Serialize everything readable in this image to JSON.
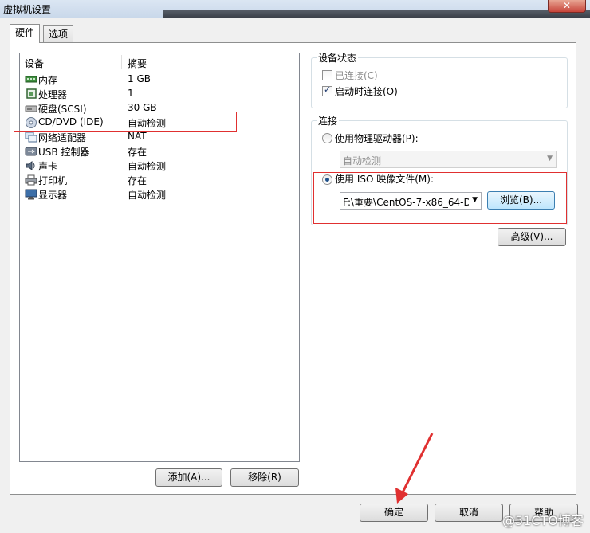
{
  "window": {
    "title": "虚拟机设置",
    "close": "✕"
  },
  "tabs": [
    {
      "label": "硬件"
    },
    {
      "label": "选项"
    }
  ],
  "devices": {
    "header": {
      "device": "设备",
      "summary": "摘要"
    },
    "rows": [
      {
        "name": "内存",
        "summary": "1 GB",
        "icon": "memory-icon"
      },
      {
        "name": "处理器",
        "summary": "1",
        "icon": "processor-icon"
      },
      {
        "name": "硬盘(SCSI)",
        "summary": "30 GB",
        "icon": "harddisk-icon"
      },
      {
        "name": "CD/DVD (IDE)",
        "summary": "自动检测",
        "icon": "cd-dvd-icon"
      },
      {
        "name": "网络适配器",
        "summary": "NAT",
        "icon": "network-adapter-icon"
      },
      {
        "name": "USB 控制器",
        "summary": "存在",
        "icon": "usb-icon"
      },
      {
        "name": "声卡",
        "summary": "自动检测",
        "icon": "sound-icon"
      },
      {
        "name": "打印机",
        "summary": "存在",
        "icon": "printer-icon"
      },
      {
        "name": "显示器",
        "summary": "自动检测",
        "icon": "display-icon"
      }
    ],
    "add_button": "添加(A)...",
    "remove_button": "移除(R)"
  },
  "device_status": {
    "legend": "设备状态",
    "connected": "已连接(C)",
    "connect_on_startup": "启动时连接(O)"
  },
  "connection": {
    "legend": "连接",
    "physical_drive": "使用物理驱动器(P):",
    "physical_drive_value": "自动检测",
    "iso_image": "使用 ISO 映像文件(M):",
    "iso_path": "F:\\重要\\CentOS-7-x86_64-D",
    "browse_button": "浏览(B)...",
    "advanced_button": "高级(V)..."
  },
  "footer": {
    "ok": "确定",
    "cancel": "取消",
    "help": "帮助"
  },
  "watermark": "@51CTO博客",
  "colors": {
    "highlight": "#e03030",
    "selection_blue": "#1d4f8a"
  }
}
